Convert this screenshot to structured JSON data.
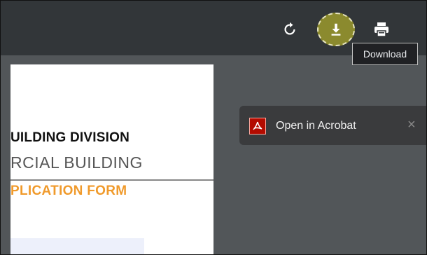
{
  "toolbar": {
    "rotate_icon": "rotate-icon",
    "download_icon": "download-icon",
    "print_icon": "print-icon",
    "tooltip": "Download"
  },
  "document": {
    "line1": "UILDING DIVISION",
    "line2": "RCIAL BUILDING",
    "line3": "PLICATION FORM",
    "accent_color": "#f09a2b"
  },
  "acrobat_banner": {
    "label": "Open in Acrobat",
    "close": "×",
    "icon": "acrobat-icon"
  }
}
